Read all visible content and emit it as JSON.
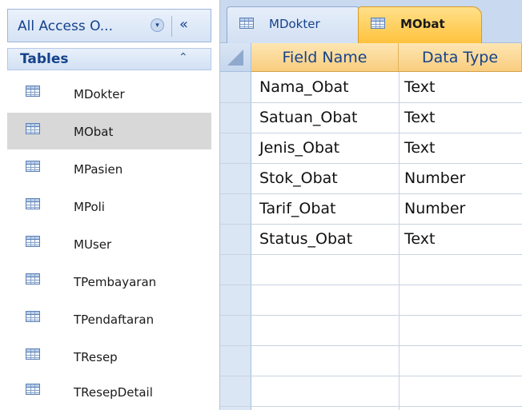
{
  "nav": {
    "title": "All Access O...",
    "dropdown_glyph": "▾",
    "collapse_glyph": "«",
    "group_title": "Tables",
    "group_toggle_glyph": "⌃",
    "items": [
      {
        "label": "MDokter"
      },
      {
        "label": "MObat",
        "selected": true
      },
      {
        "label": "MPasien"
      },
      {
        "label": "MPoli"
      },
      {
        "label": "MUser"
      },
      {
        "label": "TPembayaran"
      },
      {
        "label": "TPendaftaran"
      },
      {
        "label": "TResep"
      },
      {
        "label": "TResepDetail"
      }
    ]
  },
  "tabs": [
    {
      "label": "MDokter",
      "active": false
    },
    {
      "label": "MObat",
      "active": true
    }
  ],
  "grid": {
    "columns": [
      "Field Name",
      "Data Type"
    ],
    "rows": [
      {
        "field": "Nama_Obat",
        "type": "Text"
      },
      {
        "field": "Satuan_Obat",
        "type": "Text"
      },
      {
        "field": "Jenis_Obat",
        "type": "Text"
      },
      {
        "field": "Stok_Obat",
        "type": "Number"
      },
      {
        "field": "Tarif_Obat",
        "type": "Number"
      },
      {
        "field": "Status_Obat",
        "type": "Text"
      }
    ]
  },
  "icons": {
    "table": "table-icon"
  },
  "colors": {
    "active_tab": "#ffc23d",
    "selected_item": "#d8d8d8",
    "header_text": "#15428b"
  }
}
